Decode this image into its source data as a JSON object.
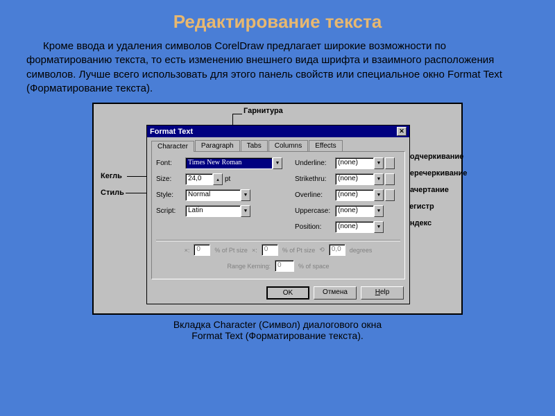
{
  "title": "Редактирование текста",
  "body": "Кроме ввода и удаления символов CorelDraw  предлагает широкие возможности по форматированию текста, то есть изменению внешнего вида шрифта и взаимного расположения символов. Лучше всего использовать для этого панель свойств или специальное окно Format Text (Форматирование текста).",
  "caption_l1": "Вкладка Character (Символ) диалогового окна",
  "caption_l2": "Format Text (Форматирование текста).",
  "dialog": {
    "title": "Format Text",
    "close": "✕",
    "tabs": [
      "Character",
      "Paragraph",
      "Tabs",
      "Columns",
      "Effects"
    ],
    "left": {
      "font_lbl": "Font:",
      "font_val": "Times New Roman",
      "size_lbl": "Size:",
      "size_val": "24,0",
      "size_unit": "pt",
      "style_lbl": "Style:",
      "style_val": "Normal",
      "script_lbl": "Script:",
      "script_val": "Latin"
    },
    "right": {
      "underline_lbl": "Underline:",
      "strike_lbl": "Strikethru:",
      "overline_lbl": "Overline:",
      "upper_lbl": "Uppercase:",
      "position_lbl": "Position:",
      "none": "(none)"
    },
    "disabled_row": {
      "shift_lbl": "Shift:",
      "pct": "% of Pt size",
      "deg": "degrees",
      "range": "Range Kerning:",
      "space": "% of space",
      "v0": "0",
      "v00": "0,0"
    },
    "buttons": {
      "ok": "OK",
      "cancel": "Отмена",
      "help": "Help"
    }
  },
  "callouts": {
    "garnitura": "Гарнитура",
    "kegl": "Кегль",
    "stil": "Стиль",
    "underline": "Подчеркивание",
    "strike": "Перечеркивание",
    "nachert": "Начертание",
    "registr": "Регистр",
    "index": "Индекс"
  }
}
